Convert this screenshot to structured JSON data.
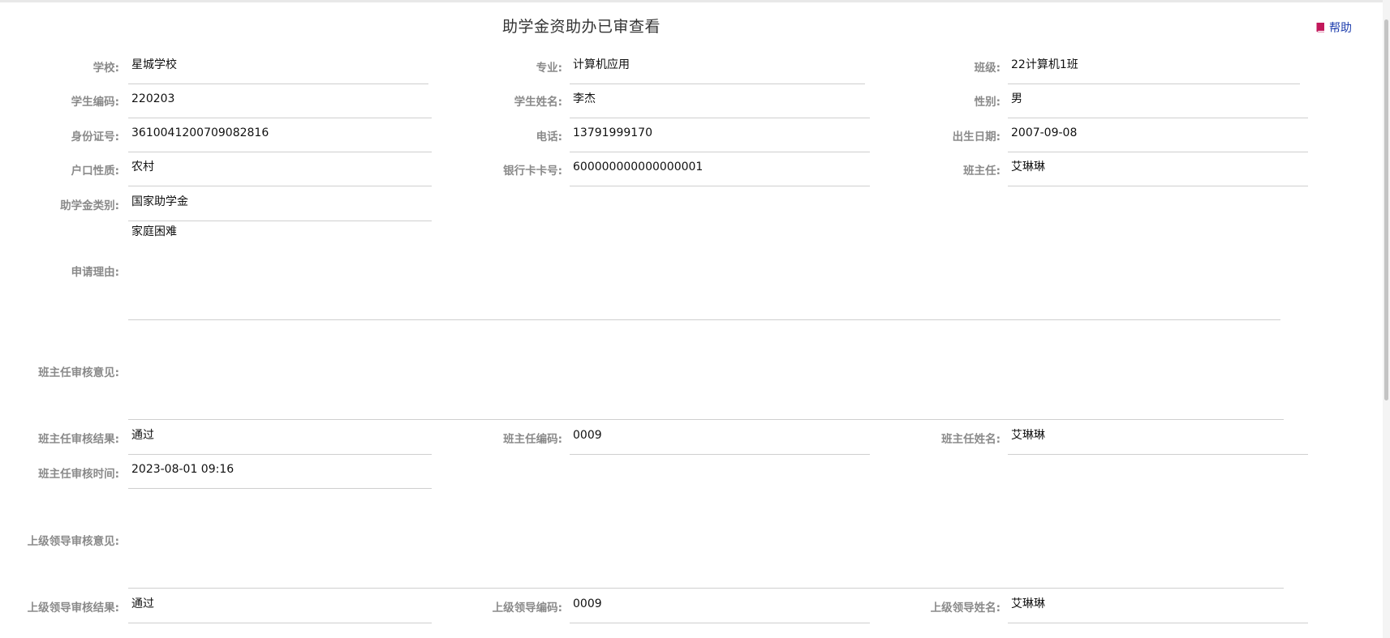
{
  "page": {
    "title": "助学金资助办已审查看",
    "help_label": "帮助"
  },
  "row1": {
    "school_label": "学校:",
    "school": "星城学校",
    "major_label": "专业:",
    "major": "计算机应用",
    "class_label": "班级:",
    "class": "22计算机1班"
  },
  "row2": {
    "student_code_label": "学生编码:",
    "student_code": "220203",
    "student_name_label": "学生姓名:",
    "student_name": "李杰",
    "gender_label": "性别:",
    "gender": "男"
  },
  "row3": {
    "id_label": "身份证号:",
    "id": "361004120070908281​6",
    "phone_label": "电话:",
    "phone": "13791999170",
    "birth_label": "出生日期:",
    "birth": "2007-09-08"
  },
  "row4": {
    "hukou_label": "户口性质:",
    "hukou": "农村",
    "bank_label": "银行卡卡号:",
    "bank": "600000000000000001",
    "teacher_label": "班主任:",
    "teacher": "艾琳琳"
  },
  "row5": {
    "grant_type_label": "助学金类别:",
    "grant_type": "国家助学金"
  },
  "reason": {
    "label": "申请理由:",
    "value": "家庭困难"
  },
  "teacher_review": {
    "opinion_label": "班主任审核意见:",
    "opinion": "",
    "result_label": "班主任审核结果:",
    "result": "通过",
    "code_label": "班主任编码:",
    "code": "0009",
    "name_label": "班主任姓名:",
    "name": "艾琳琳",
    "time_label": "班主任审核时间:",
    "time": "2023-08-01 09:16"
  },
  "leader_review": {
    "opinion_label": "上级领导审核意见:",
    "opinion": "",
    "result_label": "上级领导审核结果:",
    "result": "通过",
    "code_label": "上级领导编码:",
    "code": "0009",
    "name_label": "上级领导姓名:",
    "name": "艾琳琳"
  },
  "colors": {
    "help_icon": "#c2185b",
    "help_text": "#1f3fae"
  },
  "icons": {
    "help": "book-icon"
  }
}
